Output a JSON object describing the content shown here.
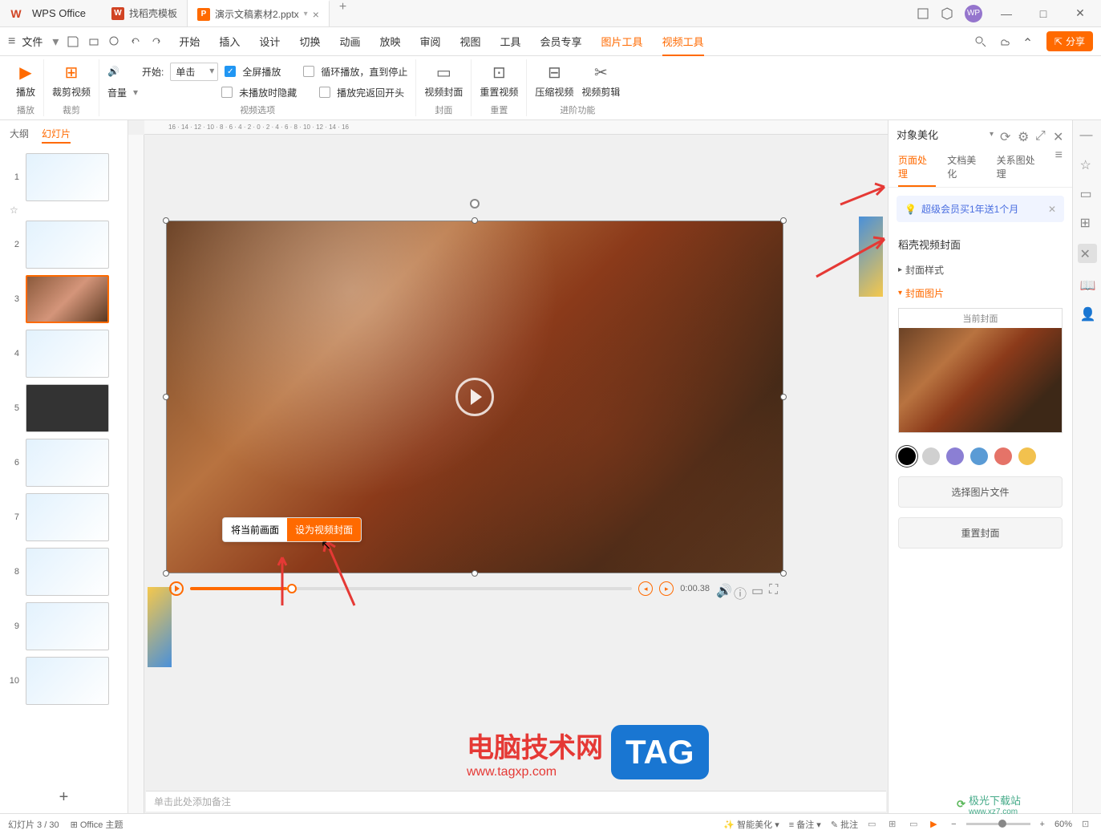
{
  "titlebar": {
    "app_name": "WPS Office",
    "tabs": [
      {
        "label": "找稻壳模板",
        "icon": "W"
      },
      {
        "label": "演示文稿素材2.pptx",
        "icon": "P"
      }
    ]
  },
  "menubar": {
    "file": "文件",
    "items": [
      "开始",
      "插入",
      "设计",
      "切换",
      "动画",
      "放映",
      "审阅",
      "视图",
      "工具",
      "会员专享",
      "图片工具",
      "视频工具"
    ],
    "share": "分享"
  },
  "ribbon": {
    "play": {
      "btn1": "播放",
      "btn2": "裁剪视频",
      "group": "播放",
      "group2": "裁剪"
    },
    "volume": {
      "label": "音量",
      "start_label": "开始:",
      "start_value": "单击"
    },
    "options": {
      "fullscreen": "全屏播放",
      "hide_not_playing": "未播放时隐藏",
      "loop": "循环播放，直到停止",
      "rewind": "播放完返回开头",
      "group": "视频选项"
    },
    "cover": {
      "btn": "视频封面",
      "reset": "重置视频",
      "group": "封面",
      "group2": "重置"
    },
    "advanced": {
      "compress": "压缩视频",
      "trim": "视频剪辑",
      "group": "进阶功能"
    }
  },
  "slide_panel": {
    "tabs": [
      "大纲",
      "幻灯片"
    ],
    "slides": [
      "1",
      "2",
      "3",
      "4",
      "5",
      "6",
      "7",
      "8",
      "9",
      "10"
    ]
  },
  "popup": {
    "current_frame": "将当前画面",
    "set_cover": "设为视频封面"
  },
  "video_controls": {
    "time": "0:00.38"
  },
  "notes": {
    "placeholder": "单击此处添加备注"
  },
  "right_panel": {
    "title": "对象美化",
    "tabs": [
      "页面处理",
      "文档美化",
      "关系图处理"
    ],
    "banner": "超级会员买1年送1个月",
    "section_title": "稻壳视频封面",
    "cover_style": "封面样式",
    "cover_image": "封面图片",
    "current_cover": "当前封面",
    "choose_file": "选择图片文件",
    "reset_cover": "重置封面",
    "colors": [
      "#000000",
      "#d0d0d0",
      "#8b7fd4",
      "#5a9bd5",
      "#e57368",
      "#f2c14e"
    ]
  },
  "statusbar": {
    "slide_info": "幻灯片 3 / 30",
    "theme": "Office 主题",
    "beautify": "智能美化",
    "notes": "备注",
    "annotate": "批注",
    "zoom": "60%"
  },
  "watermark": {
    "title": "电脑技术网",
    "url": "www.tagxp.com",
    "tag": "TAG",
    "site2": "极光下载站",
    "site2_url": "www.xz7.com"
  }
}
